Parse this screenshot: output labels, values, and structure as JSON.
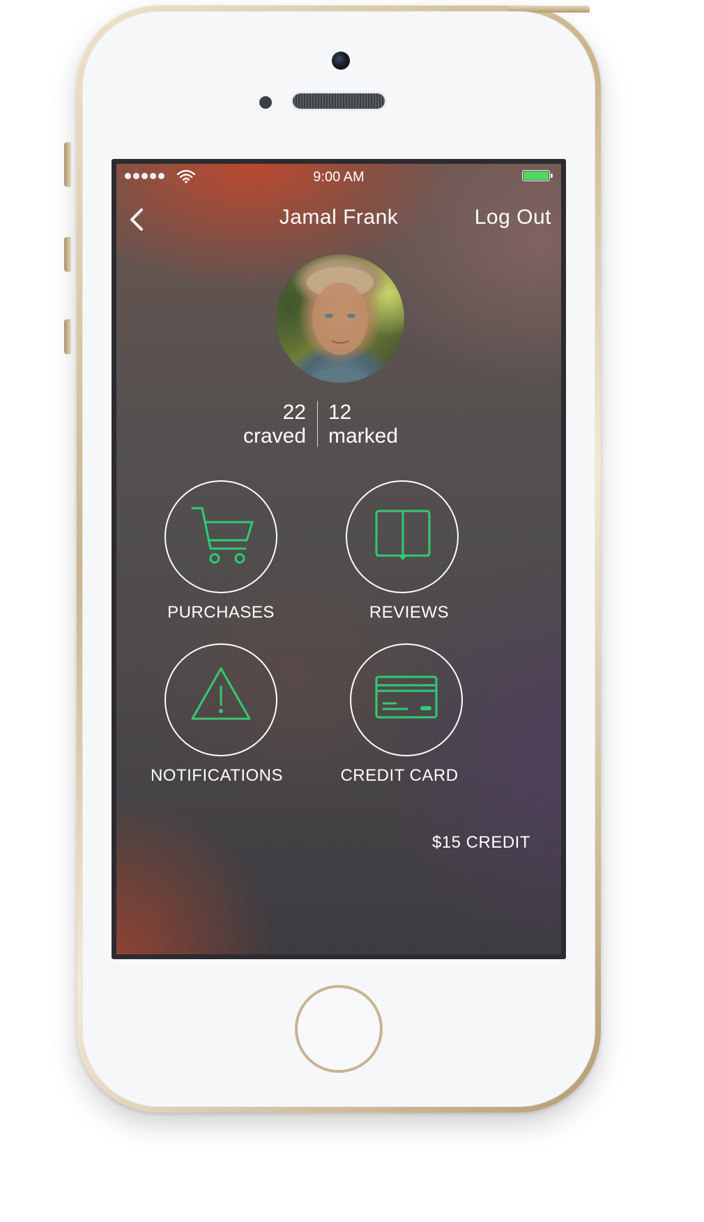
{
  "status_bar": {
    "time": "9:00 AM",
    "signal_icon": "signal-dots-icon",
    "wifi_icon": "wifi-icon",
    "battery_icon": "battery-icon",
    "battery_level": 1.0,
    "battery_color": "#4cd964"
  },
  "nav": {
    "back_icon": "chevron-left-icon",
    "title": "Jamal Frank",
    "logout_label": "Log Out"
  },
  "profile": {
    "avatar_icon": "profile-photo",
    "craved_count": "22",
    "craved_label": "craved",
    "marked_count": "12",
    "marked_label": "marked"
  },
  "actions": [
    {
      "label": "PURCHASES",
      "icon": "cart-icon"
    },
    {
      "label": "REVIEWS",
      "icon": "book-icon"
    },
    {
      "label": "NOTIFICATIONS",
      "icon": "warning-icon"
    },
    {
      "label": "CREDIT CARD",
      "icon": "credit-card-icon"
    }
  ],
  "credit": {
    "text": "$15 CREDIT"
  },
  "colors": {
    "accent": "#2ecc71",
    "text": "#ffffff"
  }
}
